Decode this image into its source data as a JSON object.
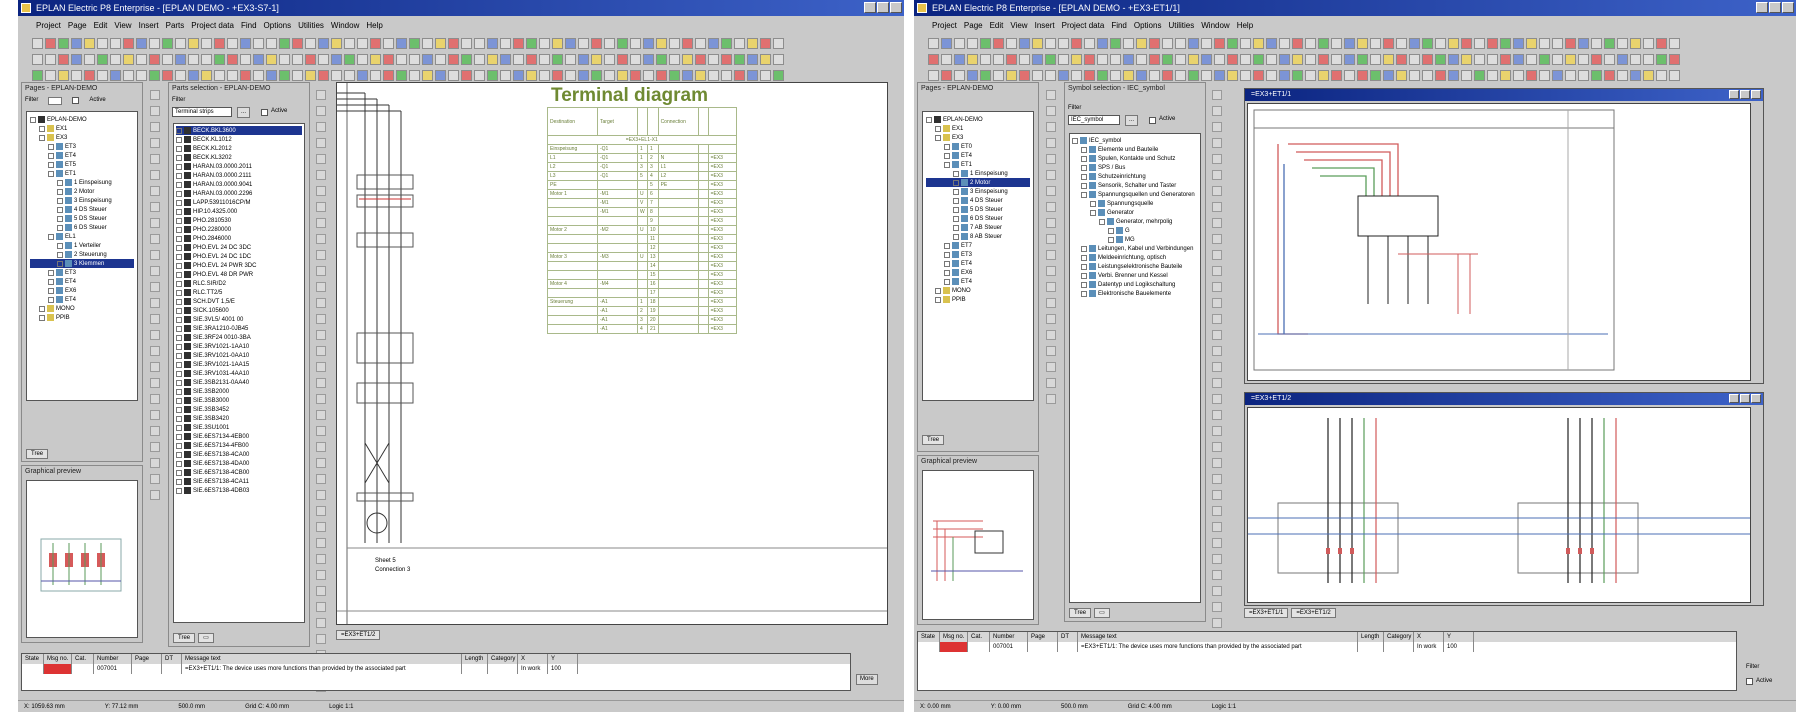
{
  "left": {
    "title": "EPLAN Electric P8 Enterprise - [EPLAN DEMO - +EX3-S7-1]",
    "menu": [
      "Project",
      "Page",
      "Edit",
      "View",
      "Insert",
      "Parts",
      "Project data",
      "Find",
      "Options",
      "Utilities",
      "Window",
      "Help"
    ],
    "pages_panel": {
      "title": "Pages - EPLAN-DEMO",
      "filter_label": "Filter",
      "active_label": "Active"
    },
    "pages_tree": [
      {
        "label": "EPLAN-DEMO",
        "indent": 0,
        "icon": "blk"
      },
      {
        "label": "EX1",
        "indent": 1,
        "icon": "y"
      },
      {
        "label": "EX3",
        "indent": 1,
        "icon": "y"
      },
      {
        "label": "ET3",
        "indent": 2,
        "icon": "b"
      },
      {
        "label": "ET4",
        "indent": 2,
        "icon": "b"
      },
      {
        "label": "ET5",
        "indent": 2,
        "icon": "b"
      },
      {
        "label": "ET1",
        "indent": 2,
        "icon": "b"
      },
      {
        "label": "1 Einspeisung",
        "indent": 3,
        "icon": "b"
      },
      {
        "label": "2 Motor",
        "indent": 3,
        "icon": "b"
      },
      {
        "label": "3 Einspeisung",
        "indent": 3,
        "icon": "b"
      },
      {
        "label": "4 DS Steuer",
        "indent": 3,
        "icon": "b"
      },
      {
        "label": "5 DS Steuer",
        "indent": 3,
        "icon": "b"
      },
      {
        "label": "6 DS Steuer",
        "indent": 3,
        "icon": "b"
      },
      {
        "label": "EL1",
        "indent": 2,
        "icon": "b"
      },
      {
        "label": "1 Verteiler",
        "indent": 3,
        "icon": "b"
      },
      {
        "label": "2 Steuerung",
        "indent": 3,
        "icon": "b"
      },
      {
        "label": "3 Klemmen",
        "indent": 3,
        "icon": "b",
        "selected": true
      },
      {
        "label": "ET3",
        "indent": 2,
        "icon": "b"
      },
      {
        "label": "ET4",
        "indent": 2,
        "icon": "b"
      },
      {
        "label": "EX6",
        "indent": 2,
        "icon": "b"
      },
      {
        "label": "ET4",
        "indent": 2,
        "icon": "b"
      },
      {
        "label": "MONO",
        "indent": 1,
        "icon": "y"
      },
      {
        "label": "PPIB",
        "indent": 1,
        "icon": "y"
      }
    ],
    "tree_tab": "Tree",
    "overview_title": "Graphical preview",
    "parts_panel": {
      "title": "Parts selection - EPLAN-DEMO",
      "filter_label": "Filter",
      "filter_value": "Terminal strips",
      "active_label": "Active"
    },
    "parts_list": [
      "BECK.BKL3600",
      "BECK.KL1012",
      "BECK.KL2012",
      "BECK.KL3202",
      "HARAN.03.0000.2011",
      "HARAN.03.0000.2111",
      "HARAN.03.0000.9041",
      "HARAN.03.0000.2296",
      "LAPP.53911016CP/M",
      "HIP.10.4325.000",
      "PHO.2810530",
      "PHO.2280000",
      "PHO.2846000",
      "PHO.EVL 24 DC 3DC",
      "PHO.EVL 24 DC 1DC",
      "PHO.EVL 24 PWR 3DC",
      "PHO.EVL 48 DR PWR",
      "RLC.SIR/D2",
      "RLC.TT2/5",
      "SCH.DVT 1,5/E",
      "SICK.105600",
      "SIE.3VL5/ 4001 00",
      "SIE.3RA1210-0JB45",
      "SIE.3RF24 0010-3BA",
      "SIE.3RV1021-1AA10",
      "SIE.3RV1021-0AA10",
      "SIE.3RV1021-1AA15",
      "SIE.3RV1031-4AA10",
      "SIE.3SB2131-0AA40",
      "SIE.3SB2000",
      "SIE.3SB3000",
      "SIE.3SB3452",
      "SIE.3SB3420",
      "SIE.3SU1001",
      "SIE.6ES7134-4EB00",
      "SIE.6ES7134-4FB00",
      "SIE.6ES7138-4CA00",
      "SIE.6ES7138-4DA00",
      "SIE.6ES7138-4CB00",
      "SIE.6ES7138-4CA11",
      "SIE.6ES7138-4DB03"
    ],
    "parts_tab": "Tree",
    "diagram_title": "Terminal diagram",
    "diagram_note_1": "Sheet 5",
    "diagram_note_2": "Connection 3",
    "td_cols": [
      "Destination",
      "Target",
      "",
      "",
      "Connection",
      "",
      ""
    ],
    "td_header_row": "=EX3+EL1-X1",
    "td_rows": [
      [
        "Einspeisung",
        "-Q1",
        "1",
        "1",
        "",
        "",
        ""
      ],
      [
        "L1",
        "-Q1",
        "1",
        "2",
        "N",
        "",
        "=EX3"
      ],
      [
        "L2",
        "-Q1",
        "3",
        "3",
        "L1",
        "",
        "=EX3"
      ],
      [
        "L3",
        "-Q1",
        "5",
        "4",
        "L2",
        "",
        "=EX3"
      ],
      [
        "PE",
        "",
        "",
        "5",
        "PE",
        "",
        "=EX3"
      ],
      [
        "Motor 1",
        "-M1",
        "U",
        "6",
        "",
        "",
        "=EX3"
      ],
      [
        "",
        "-M1",
        "V",
        "7",
        "",
        "",
        "=EX3"
      ],
      [
        "",
        "-M1",
        "W",
        "8",
        "",
        "",
        "=EX3"
      ],
      [
        "",
        "",
        "",
        "9",
        "",
        "",
        "=EX3"
      ],
      [
        "Motor 2",
        "-M2",
        "U",
        "10",
        "",
        "",
        "=EX3"
      ],
      [
        "",
        "",
        "",
        "11",
        "",
        "",
        "=EX3"
      ],
      [
        "",
        "",
        "",
        "12",
        "",
        "",
        "=EX3"
      ],
      [
        "Motor 3",
        "-M3",
        "U",
        "13",
        "",
        "",
        "=EX3"
      ],
      [
        "",
        "",
        "",
        "14",
        "",
        "",
        "=EX3"
      ],
      [
        "",
        "",
        "",
        "15",
        "",
        "",
        "=EX3"
      ],
      [
        "Motor 4",
        "-M4",
        "",
        "16",
        "",
        "",
        "=EX3"
      ],
      [
        "",
        "",
        "",
        "17",
        "",
        "",
        "=EX3"
      ],
      [
        "Steuerung",
        "-A1",
        "1",
        "18",
        "",
        "",
        "=EX3"
      ],
      [
        "",
        "-A1",
        "2",
        "19",
        "",
        "",
        "=EX3"
      ],
      [
        "",
        "-A1",
        "3",
        "20",
        "",
        "",
        "=EX3"
      ],
      [
        "",
        "-A1",
        "4",
        "21",
        "",
        "",
        "=EX3"
      ]
    ],
    "sheet_tab": "=EX3+ET1/2",
    "messages": {
      "cols": [
        "State",
        "Msg no.",
        "Cat.",
        "Number",
        "Page",
        "DT",
        "Message text",
        "Length",
        "Category",
        "X",
        "Y"
      ],
      "row": [
        "",
        "",
        "",
        "007001",
        "",
        "",
        "=EX3+ET1/1: The device uses more functions than provided by the associated part",
        "",
        "",
        "In work",
        "100"
      ]
    },
    "status": [
      "X: 1059.63 mm",
      "Y: 77.12 mm",
      "500.0 mm",
      "Grid C: 4.00 mm",
      "Logic 1:1"
    ],
    "more_label": "More"
  },
  "right": {
    "title": "EPLAN Electric P8 Enterprise - [EPLAN DEMO - +EX3-ET1/1]",
    "menu": [
      "Project",
      "Page",
      "Edit",
      "View",
      "Insert",
      "Project data",
      "Find",
      "Options",
      "Utilities",
      "Window",
      "Help"
    ],
    "pages_panel": {
      "title": "Pages - EPLAN-DEMO"
    },
    "pages_tree": [
      {
        "label": "EPLAN-DEMO",
        "indent": 0,
        "icon": "blk"
      },
      {
        "label": "EX1",
        "indent": 1,
        "icon": "y"
      },
      {
        "label": "EX3",
        "indent": 1,
        "icon": "y"
      },
      {
        "label": "ET0",
        "indent": 2,
        "icon": "b"
      },
      {
        "label": "ET4",
        "indent": 2,
        "icon": "b"
      },
      {
        "label": "ET1",
        "indent": 2,
        "icon": "b"
      },
      {
        "label": "1 Einspeisung",
        "indent": 3,
        "icon": "b"
      },
      {
        "label": "2 Motor",
        "indent": 3,
        "icon": "b",
        "selected": true
      },
      {
        "label": "3 Einspeisung",
        "indent": 3,
        "icon": "b"
      },
      {
        "label": "4 DS Steuer",
        "indent": 3,
        "icon": "b"
      },
      {
        "label": "5 DS Steuer",
        "indent": 3,
        "icon": "b"
      },
      {
        "label": "6 DS Steuer",
        "indent": 3,
        "icon": "b"
      },
      {
        "label": "7 AB Steuer",
        "indent": 3,
        "icon": "b"
      },
      {
        "label": "8 AB Steuer",
        "indent": 3,
        "icon": "b"
      },
      {
        "label": "ET7",
        "indent": 2,
        "icon": "b"
      },
      {
        "label": "ET3",
        "indent": 2,
        "icon": "b"
      },
      {
        "label": "ET4",
        "indent": 2,
        "icon": "b"
      },
      {
        "label": "EX6",
        "indent": 2,
        "icon": "b"
      },
      {
        "label": "ET4",
        "indent": 2,
        "icon": "b"
      },
      {
        "label": "MONO",
        "indent": 1,
        "icon": "y"
      },
      {
        "label": "PPIB",
        "indent": 1,
        "icon": "y"
      }
    ],
    "tree_tab": "Tree",
    "preview_title": "Graphical preview",
    "symbol_panel": {
      "title": "Symbol selection - IEC_symbol",
      "filter_label": "Filter",
      "filter_value": "IEC_symbol",
      "active_label": "Active"
    },
    "symbol_tree": [
      {
        "label": "IEC_symbol",
        "indent": 0
      },
      {
        "label": "Elemente und Bauteile",
        "indent": 1
      },
      {
        "label": "Spulen, Kontakte und Schutz",
        "indent": 1
      },
      {
        "label": "SPS / Bus",
        "indent": 1
      },
      {
        "label": "Schutzeinrichtung",
        "indent": 1
      },
      {
        "label": "Sensorik, Schalter und Taster",
        "indent": 1
      },
      {
        "label": "Spannungsquellen und Generatoren",
        "indent": 1
      },
      {
        "label": "Spannungsquelle",
        "indent": 2
      },
      {
        "label": "Generator",
        "indent": 2
      },
      {
        "label": "Generator, mehrpolig",
        "indent": 3
      },
      {
        "label": "G",
        "indent": 4
      },
      {
        "label": "MG",
        "indent": 4
      },
      {
        "label": "Leitungen, Kabel und Verbindungen",
        "indent": 1
      },
      {
        "label": "Meldeeinrichtung, optisch",
        "indent": 1
      },
      {
        "label": "Leistungselektronische Bauteile",
        "indent": 1
      },
      {
        "label": "Verbi. Brenner und Kessel",
        "indent": 1
      },
      {
        "label": "Datentyp und Logikschaltung",
        "indent": 1
      },
      {
        "label": "Elektronische Bauelemente",
        "indent": 1
      }
    ],
    "symbol_tab": "Tree",
    "sheet1_title": "=EX3+ET1/1",
    "sheet2_title": "=EX3+ET1/2",
    "sheet_tabs": [
      "=EX3+ET1/1",
      "=EX3+ET1/2"
    ],
    "messages": {
      "cols": [
        "State",
        "Msg no.",
        "Cat.",
        "Number",
        "Page",
        "DT",
        "Message text",
        "Length",
        "Category",
        "X",
        "Y"
      ],
      "row": [
        "",
        "",
        "",
        "007001",
        "",
        "",
        "=EX3+ET1/1: The device uses more functions than provided by the associated part",
        "",
        "",
        "In work",
        "100"
      ]
    },
    "filter_label": "Filter",
    "active_label": "Active",
    "status": [
      "X: 0.00 mm",
      "Y: 0.00 mm",
      "500.0 mm",
      "Grid C: 4.00 mm",
      "Logic 1:1"
    ]
  }
}
